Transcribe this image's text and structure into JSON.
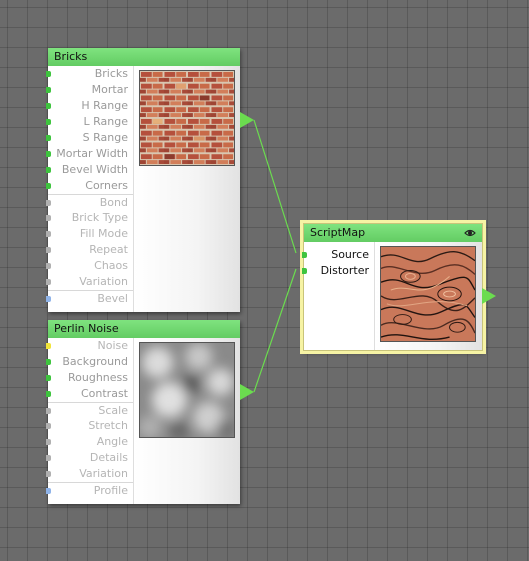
{
  "colors": {
    "canvas": "#6b6b6b",
    "header": "#6fd66f",
    "wire": "#6bdc4f",
    "selection": "#f6f3a4"
  },
  "nodes": {
    "bricks": {
      "title": "Bricks",
      "ports": [
        {
          "label": "Bricks",
          "state": "connected-green"
        },
        {
          "label": "Mortar",
          "state": "connected-green"
        },
        {
          "label": "H Range",
          "state": "connected-green"
        },
        {
          "label": "L Range",
          "state": "connected-green"
        },
        {
          "label": "S Range",
          "state": "connected-green"
        },
        {
          "label": "Mortar Width",
          "state": "connected-green"
        },
        {
          "label": "Bevel Width",
          "state": "connected-green"
        },
        {
          "label": "Corners",
          "state": "connected-green"
        },
        {
          "label": "Bond",
          "state": "grey"
        },
        {
          "label": "Brick Type",
          "state": "grey"
        },
        {
          "label": "Fill Mode",
          "state": "grey"
        },
        {
          "label": "Repeat",
          "state": "grey"
        },
        {
          "label": "Chaos",
          "state": "grey"
        },
        {
          "label": "Variation",
          "state": "grey"
        },
        {
          "label": "Bevel",
          "state": "blue"
        }
      ],
      "preview": "brick-texture"
    },
    "perlin": {
      "title": "Perlin Noise",
      "ports": [
        {
          "label": "Noise",
          "state": "yellow"
        },
        {
          "label": "Background",
          "state": "connected-green"
        },
        {
          "label": "Roughness",
          "state": "connected-green"
        },
        {
          "label": "Contrast",
          "state": "connected-green"
        },
        {
          "label": "Scale",
          "state": "grey"
        },
        {
          "label": "Stretch",
          "state": "grey"
        },
        {
          "label": "Angle",
          "state": "grey"
        },
        {
          "label": "Details",
          "state": "grey"
        },
        {
          "label": "Variation",
          "state": "grey"
        },
        {
          "label": "Profile",
          "state": "blue"
        }
      ],
      "preview": "cloud-noise-texture"
    },
    "scriptmap": {
      "title": "ScriptMap",
      "ports": [
        {
          "label": "Source",
          "state": "connected-green"
        },
        {
          "label": "Distorter",
          "state": "connected-green"
        }
      ],
      "preview": "marble-distortion-texture",
      "icon": "eye-icon"
    }
  }
}
